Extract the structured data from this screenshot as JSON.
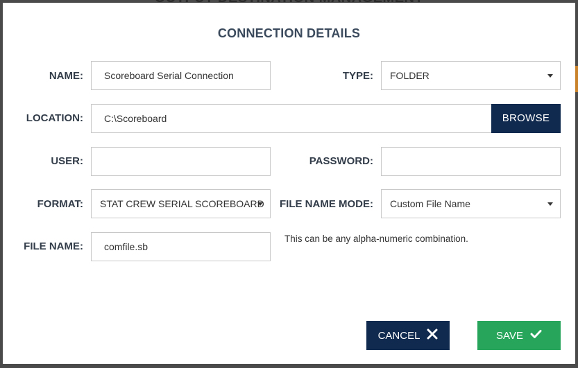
{
  "background": {
    "page_title": "OUTPUT DESTINATION MANAGEMENT"
  },
  "dialog": {
    "title": "CONNECTION DETAILS",
    "name": {
      "label": "NAME:",
      "value": "Scoreboard Serial Connection"
    },
    "type": {
      "label": "TYPE:",
      "value": "FOLDER"
    },
    "location": {
      "label": "LOCATION:",
      "value": "C:\\Scoreboard",
      "browse_label": "BROWSE"
    },
    "user": {
      "label": "USER:",
      "value": ""
    },
    "password": {
      "label": "PASSWORD:",
      "value": ""
    },
    "format": {
      "label": "FORMAT:",
      "value": "STAT CREW SERIAL SCOREBOARD"
    },
    "file_name_mode": {
      "label": "FILE NAME MODE:",
      "value": "Custom File Name"
    },
    "file_name": {
      "label": "FILE NAME:",
      "value": "comfile.sb",
      "hint": "This can be any alpha-numeric combination."
    },
    "cancel_label": "CANCEL",
    "save_label": "SAVE"
  },
  "icons": {
    "select_caret": "caret-down-icon",
    "cancel": "close-icon",
    "save": "check-icon"
  },
  "colors": {
    "primary_navy": "#10294f",
    "save_green": "#27a55a",
    "label_text": "#333d4a",
    "border": "#c8c8c8"
  }
}
